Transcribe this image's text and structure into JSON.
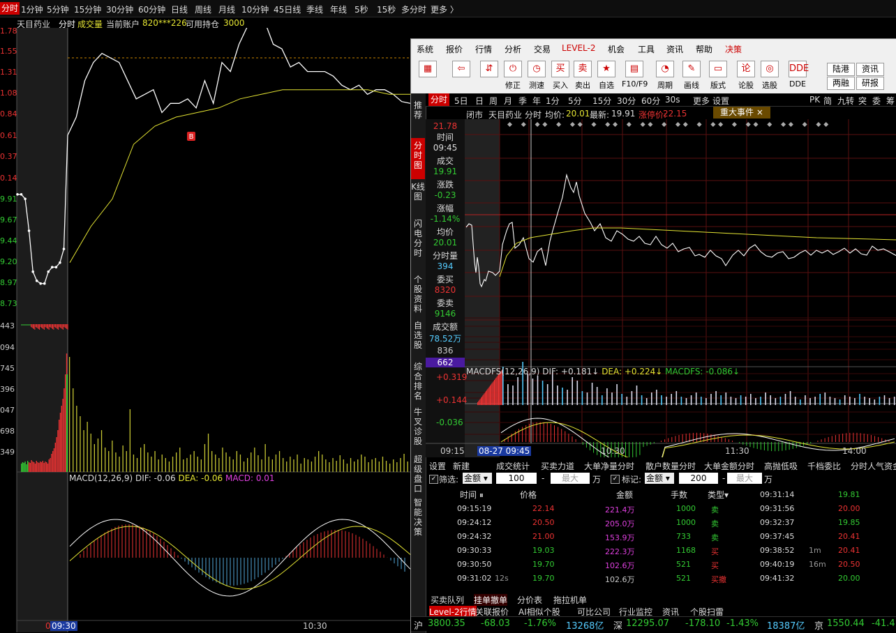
{
  "topbar": {
    "tabs": [
      "分时",
      "1分钟",
      "5分钟",
      "15分钟",
      "30分钟",
      "60分钟",
      "日线",
      "周线",
      "月线",
      "10分钟",
      "45日线",
      "季线",
      "年线",
      "5秒",
      "15秒",
      "多分时",
      "更多 〉"
    ]
  },
  "left": {
    "stock": "天目药业",
    "mode": "分时",
    "indicator": "成交量",
    "account_label": "当前账户",
    "account_id": "820***226",
    "avail_label": "可用持仓",
    "avail_value": "3000",
    "close_icon": "×",
    "price_ticks": [
      "1.78",
      "1.55",
      "1.31",
      "1.08",
      "0.84",
      "0.61",
      "0.37",
      "0.14",
      "9.91",
      "9.67",
      "9.44",
      "9.20",
      "8.97",
      "8.73",
      "443",
      "094",
      "745",
      "396",
      "047",
      "698",
      "349"
    ],
    "macd_label": "MACD(12,26,9)",
    "dif": "DIF: -0.06",
    "dea": "DEA: -0.06",
    "macd": "MACD: 0.01",
    "x_tick_0": "0",
    "x_tick_1": "09:30",
    "x_tick_2": "10:30",
    "buy_marker": "B"
  },
  "popup": {
    "menu": [
      "系统",
      "报价",
      "行情",
      "分析",
      "交易",
      "LEVEL-2",
      "机会",
      "工具",
      "资讯",
      "帮助",
      "决策"
    ],
    "toolbar": [
      {
        "label": "",
        "icon": "tiles-icon",
        "glyph": "▦"
      },
      {
        "label": "",
        "icon": "back-arrow-icon",
        "glyph": "⇦"
      },
      {
        "label": "",
        "icon": "up-down-icon",
        "glyph": "⇵"
      },
      {
        "label": "修正",
        "icon": "correct-icon",
        "glyph": "⏻"
      },
      {
        "label": "测速",
        "icon": "clock-icon",
        "glyph": "◷"
      },
      {
        "label": "买入",
        "icon": "buy-icon",
        "glyph": "买"
      },
      {
        "label": "卖出",
        "icon": "sell-icon",
        "glyph": "卖"
      },
      {
        "label": "自选",
        "icon": "star-icon",
        "glyph": "★"
      },
      {
        "label": "F10/F9",
        "icon": "f10-icon",
        "glyph": "▤"
      },
      {
        "label": "周期",
        "icon": "cycle-icon",
        "glyph": "◔"
      },
      {
        "label": "画线",
        "icon": "pencil-icon",
        "glyph": "✎"
      },
      {
        "label": "版式",
        "icon": "layout-icon",
        "glyph": "▭"
      },
      {
        "label": "论股",
        "icon": "discuss-icon",
        "glyph": "论"
      },
      {
        "label": "选股",
        "icon": "select-stock-icon",
        "glyph": "◎"
      },
      {
        "label": "DDE",
        "icon": "dde-icon",
        "glyph": "DDE"
      }
    ],
    "side_buttons": [
      "陆港",
      "资讯",
      "两融",
      "研报"
    ],
    "vtabs": [
      "推荐",
      "分时图",
      "K线图",
      "闪电分时",
      "个股资料",
      "自选股",
      "综合排名",
      "牛叉诊股",
      "超级盘口",
      "智能决策"
    ],
    "ptabs": [
      "分时",
      "5日",
      "日",
      "周",
      "月",
      "季",
      "年",
      "1分",
      "5分",
      "15分",
      "30分",
      "60分",
      "30s",
      "更多",
      "设置",
      "PK",
      "简",
      "九转",
      "突",
      "委",
      "筹"
    ],
    "info": {
      "status": "闭市",
      "stock": "天目药业",
      "mode": "分时",
      "avg_label": "均价:",
      "avg": "20.01",
      "last_label": "最新:",
      "last": "19.91",
      "limit_label": "涨停价:",
      "limit": "22.15",
      "event": "重大事件"
    },
    "sidebox": {
      "top_price": "21.78",
      "time_label": "时间",
      "time": "09:45",
      "deal_label": "成交",
      "deal": "19.91",
      "chg_label": "涨跌",
      "chg": "-0.23",
      "pct_label": "涨幅",
      "pct": "-1.14%",
      "avg_label": "均价",
      "avg": "20.01",
      "vol_label": "分时量",
      "vol": "394",
      "bid_label": "委买",
      "bid": "8320",
      "ask_label": "委卖",
      "ask": "9146",
      "amt_label": "成交额",
      "amt": "78.52万",
      "vol_tick_1": "836",
      "vol_tick_2": "662"
    },
    "macd": {
      "label": "MACDFS(12,26,9)",
      "dif": "DIF: +0.181↓",
      "dea": "DEA: +0.224↓",
      "macdfs": "MACDFS: -0.086↓",
      "ticks": [
        "+0.319",
        "+0.144",
        "-0.036"
      ]
    },
    "xaxis": {
      "t0": "09:15",
      "t1": "08-27 09:45",
      "t2": "10:30",
      "t3": "11:30",
      "t4": "14:00"
    },
    "dtabs": [
      "设置",
      "新建",
      "成交统计",
      "买卖力道",
      "大单净量分时",
      "散户数量分时",
      "大单金额分时",
      "高抛低吸",
      "千档委比",
      "分时人气资金"
    ],
    "filter": {
      "filter_label": "筛选:",
      "filter_sel": "金额",
      "filter_val": "100",
      "dash": "-",
      "max_ph": "最大",
      "unit": "万",
      "mark_label": "标记:",
      "mark_sel": "金额",
      "mark_val": "200"
    },
    "trades_header": {
      "time": "时间",
      "price": "价格",
      "amount": "金额",
      "lots": "手数",
      "type": "类型▾"
    },
    "trades": [
      {
        "time": "09:15:19",
        "extra": "",
        "price": "22.14",
        "amount": "221.4万",
        "lots": "1000",
        "type": "卖"
      },
      {
        "time": "09:24:12",
        "extra": "",
        "price": "20.50",
        "amount": "205.0万",
        "lots": "1000",
        "type": "卖"
      },
      {
        "time": "09:24:32",
        "extra": "",
        "price": "21.00",
        "amount": "153.9万",
        "lots": "733",
        "type": "卖"
      },
      {
        "time": "09:30:33",
        "extra": "",
        "price": "19.03",
        "amount": "222.3万",
        "lots": "1168",
        "type": "买"
      },
      {
        "time": "09:30:50",
        "extra": "",
        "price": "19.70",
        "amount": "102.6万",
        "lots": "521",
        "type": "买"
      },
      {
        "time": "09:31:02",
        "extra": "12s",
        "price": "19.70",
        "amount": "102.6万",
        "lots": "521",
        "type": "买撤"
      }
    ],
    "trades_right": [
      {
        "time": "09:31:14",
        "extra": "",
        "price": "19.81"
      },
      {
        "time": "09:31:56",
        "extra": "",
        "price": "20.00"
      },
      {
        "time": "09:32:37",
        "extra": "",
        "price": "19.85"
      },
      {
        "time": "09:37:45",
        "extra": "",
        "price": "20.41"
      },
      {
        "time": "09:38:52",
        "extra": "1m",
        "price": "20.41"
      },
      {
        "time": "09:40:19",
        "extra": "16m",
        "price": "20.50"
      },
      {
        "time": "09:41:32",
        "extra": "",
        "price": "20.00"
      }
    ],
    "btabs": [
      "买卖队列",
      "挂单撤单",
      "分价表",
      "拖拉机单"
    ],
    "btabs2": [
      "Level-2行情",
      "关联报价",
      "AI相似个股",
      "可比公司",
      "行业监控",
      "资讯",
      "个股扫雷"
    ],
    "status": {
      "sh_label": "沪",
      "sh_idx": "3800.35",
      "sh_chg": "-68.03",
      "sh_pct": "-1.76%",
      "sh_amt": "13268亿",
      "sz_label": "深",
      "sz_idx": "12295.07",
      "sz_chg": "-178.10",
      "sz_pct": "-1.43%",
      "sz_amt": "18387亿",
      "bj_label": "京",
      "bj_idx": "1550.44",
      "bj_chg": "-41.4"
    }
  },
  "chart_data": [
    {
      "type": "line",
      "title": "天目药业 分时",
      "series": [
        {
          "name": "price",
          "x_range": [
            "09:15",
            "10:40"
          ],
          "values": [
            19.95,
            19.95,
            19.9,
            19.55,
            19.1,
            19.0,
            18.97,
            18.97,
            19.1,
            19.15,
            19.15,
            19.2,
            19.35,
            20.6,
            20.8,
            21.2,
            21.4,
            21.5,
            21.45,
            21.4,
            21.2,
            21.0,
            21.05,
            21.1,
            20.85,
            20.95,
            20.95,
            21.0,
            20.9,
            21.2,
            20.95,
            21.4,
            21.3,
            21.6,
            21.8,
            21.95,
            21.85,
            21.6,
            21.55,
            21.35,
            21.4,
            21.3,
            21.3,
            21.3,
            21.25,
            21.15,
            21.1,
            21.15,
            21.05,
            21.1,
            21.1,
            21.05,
            20.97,
            20.95
          ]
        },
        {
          "name": "avg",
          "values": [
            19.2,
            19.6,
            19.9,
            20.5,
            20.7,
            20.8,
            20.85,
            20.9,
            21.0,
            21.05,
            21.1,
            21.1,
            21.1,
            21.1,
            21.1,
            21.05,
            21.05
          ]
        }
      ],
      "price_ticks": [
        "1.78",
        "1.55",
        "1.31",
        "1.08",
        "0.84",
        "0.61",
        "0.37",
        "0.14",
        "9.91",
        "9.67",
        "9.44",
        "9.20",
        "8.97",
        "8.73"
      ]
    },
    {
      "type": "bar",
      "title": "成交量",
      "ticks": [
        "443",
        "094",
        "745",
        "396",
        "047",
        "698",
        "349"
      ]
    },
    {
      "type": "line",
      "title": "MACD(12,26,9)",
      "series": [
        {
          "name": "DIF",
          "values": [
            -0.06
          ]
        },
        {
          "name": "DEA",
          "values": [
            -0.06
          ]
        },
        {
          "name": "MACD",
          "values": [
            0.01
          ]
        }
      ]
    },
    {
      "type": "line",
      "title": "天目药业 分时 (popup)",
      "ylim": [
        17.9,
        21.78
      ],
      "series": [
        {
          "name": "price",
          "last": 19.91
        },
        {
          "name": "avg",
          "last": 20.01
        }
      ],
      "limit_up": 22.15
    },
    {
      "type": "line",
      "title": "MACDFS(12,26,9)",
      "series": [
        {
          "name": "DIF",
          "last": 0.181
        },
        {
          "name": "DEA",
          "last": 0.224
        },
        {
          "name": "MACDFS",
          "last": -0.086
        }
      ],
      "yticks": [
        0.319,
        0.144,
        -0.036
      ]
    }
  ]
}
